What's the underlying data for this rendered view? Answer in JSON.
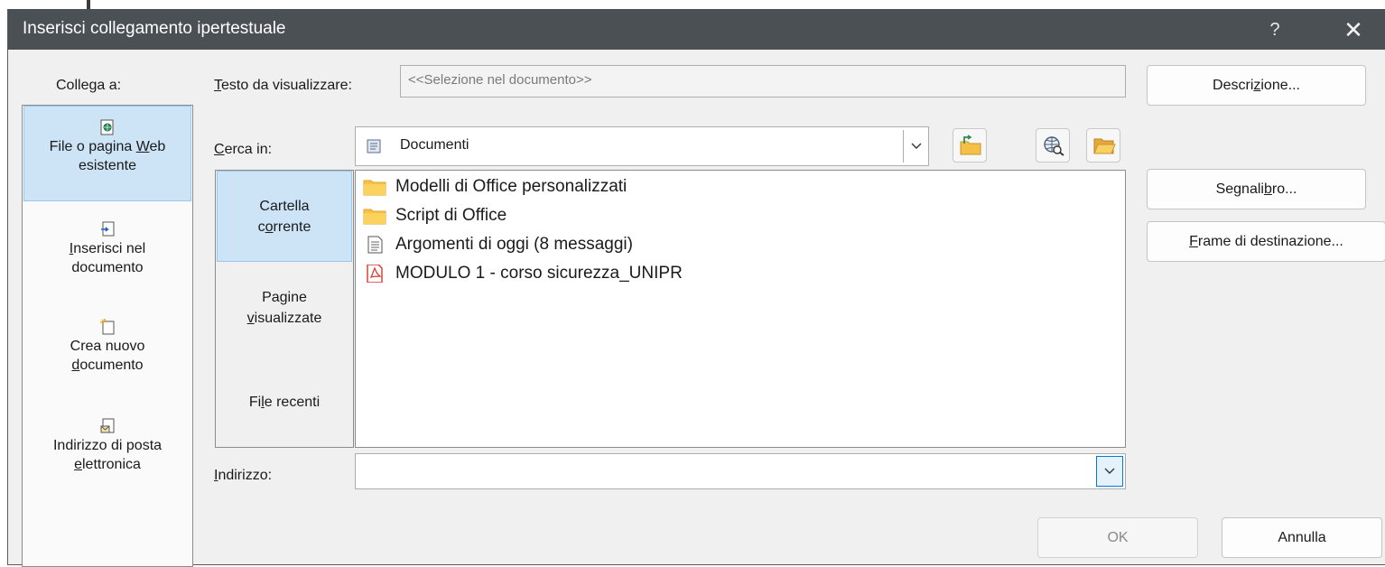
{
  "dialog": {
    "title": "Inserisci collegamento ipertestuale",
    "help_label": "?",
    "close_label": "✕"
  },
  "nav": {
    "heading": "Collega a:",
    "items": [
      {
        "line1": "File o pagina ",
        "u": "W",
        "line1b": "eb",
        "line2": "esistente",
        "icon": "web-page-icon"
      },
      {
        "u": "I",
        "line1": "nserisci nel",
        "line2": "documento",
        "icon": "place-in-document-icon"
      },
      {
        "line1": "Crea nuovo",
        "u": "d",
        "line2": "ocumento",
        "icon": "new-document-icon"
      },
      {
        "line1": "Indirizzo di posta",
        "u": "e",
        "line2": "lettronica",
        "icon": "email-address-icon"
      }
    ]
  },
  "text_to_display": {
    "label_u": "T",
    "label_rest": "esto da visualizzare:",
    "value": "<<Selezione nel documento>>"
  },
  "look_in": {
    "label_u": "C",
    "label_rest": "erca in:",
    "value": "Documenti"
  },
  "side_tabs": [
    {
      "line1": "Cartella",
      "line2_pre": "c",
      "line2_u": "o",
      "line2_post": "rrente"
    },
    {
      "line1": "Pagine",
      "line2_pre": "",
      "line2_u": "v",
      "line2_post": "isualizzate"
    },
    {
      "line1_pre": "Fi",
      "line1_u": "l",
      "line1_post": "e recenti"
    }
  ],
  "files": [
    {
      "name": "Modelli di Office personalizzati",
      "icon": "folder-icon"
    },
    {
      "name": "Script di Office",
      "icon": "folder-icon"
    },
    {
      "name": "Argomenti di oggi (8 messaggi)",
      "icon": "text-file-icon"
    },
    {
      "name": "MODULO 1 - corso sicurezza_UNIPR",
      "icon": "pdf-file-icon"
    }
  ],
  "address": {
    "label_u": "I",
    "label_rest": "ndirizzo:",
    "value": ""
  },
  "buttons": {
    "screentip_pre": "Descri",
    "screentip_u": "z",
    "screentip_post": "ione...",
    "bookmark_pre": "Segnali",
    "bookmark_u": "b",
    "bookmark_post": "ro...",
    "target_u": "F",
    "target_post": "rame di destinazione...",
    "ok": "OK",
    "cancel": "Annulla"
  },
  "colors": {
    "titlebar": "#4a5054",
    "selected": "#cde4f7",
    "folder": "#f7c244",
    "pdf": "#d9342b"
  }
}
